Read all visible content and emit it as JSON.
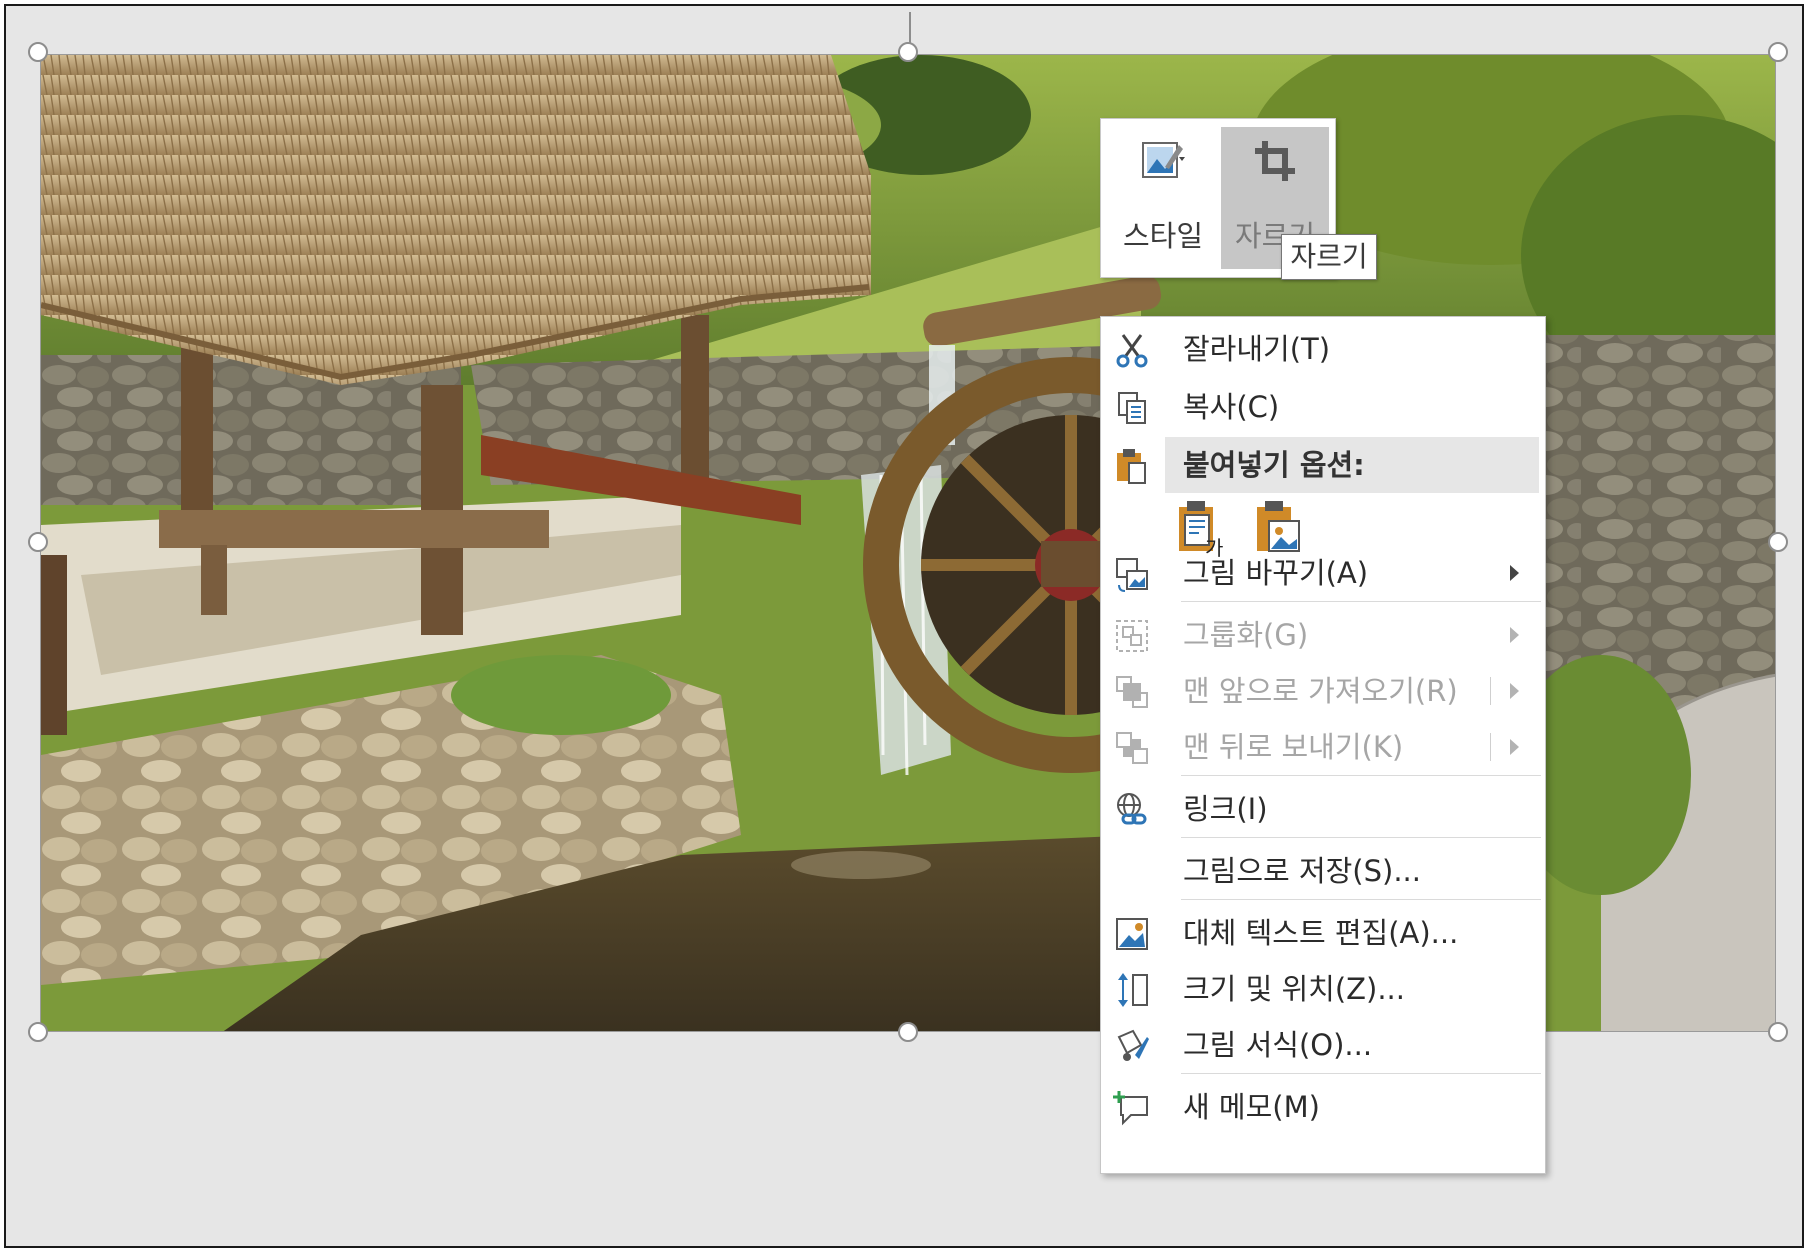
{
  "mini_toolbar": {
    "style_label": "스타일",
    "crop_label": "자르기",
    "crop_tooltip": "자르기"
  },
  "context_menu": {
    "cut": "잘라내기(T)",
    "copy": "복사(C)",
    "paste_options": "붙여넣기 옵션:",
    "change_picture": "그림 바꾸기(A)",
    "group": "그룹화(G)",
    "bring_to_front": "맨 앞으로 가져오기(R)",
    "send_to_back": "맨 뒤로 보내기(K)",
    "link": "링크(I)",
    "save_as_picture": "그림으로 저장(S)...",
    "edit_alt_text": "대체 텍스트 편집(A)...",
    "size_position": "크기 및 위치(Z)...",
    "format_picture": "그림 서식(O)..."
  },
  "new_comment": "새 메모(M)",
  "colors": {
    "accent_blue": "#2e75b6",
    "paste_orange": "#d08a28",
    "highlight_gray": "#e6e6e6"
  }
}
